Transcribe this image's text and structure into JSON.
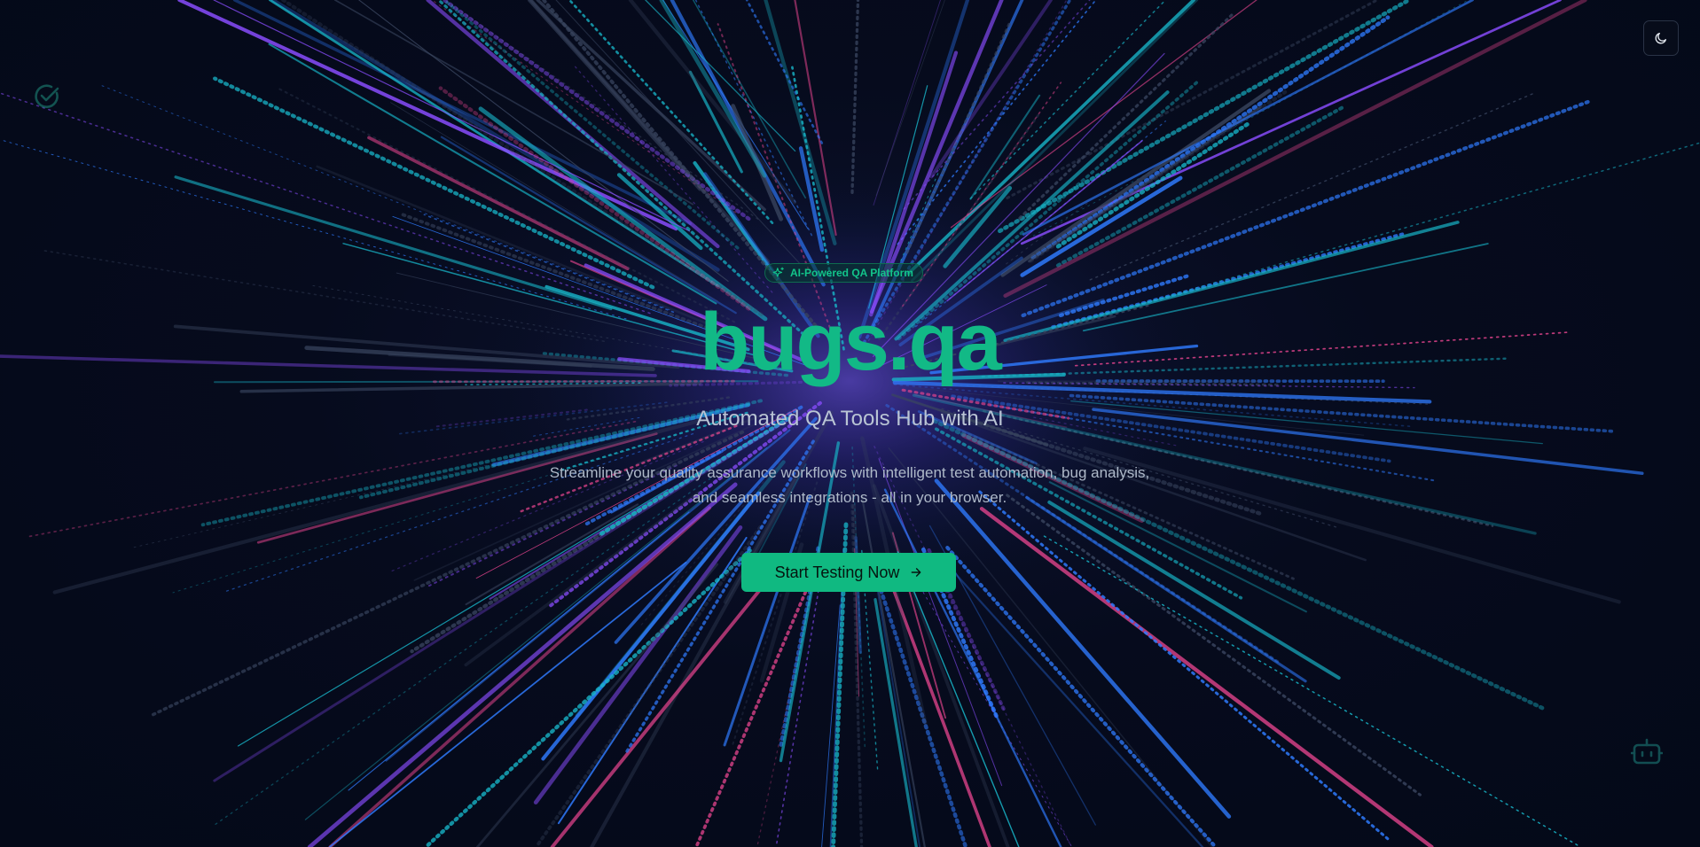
{
  "header": {
    "theme_toggle_icon": "moon-icon"
  },
  "decorations": {
    "top_left_icon": "check-circle-icon",
    "bottom_right_icon": "bot-icon"
  },
  "hero": {
    "badge_icon": "sparkles-icon",
    "badge_label": "AI-Powered QA Platform",
    "title": "bugs.qa",
    "subtitle": "Automated QA Tools Hub with AI",
    "description": "Streamline your quality assurance workflows with intelligent test automation, bug analysis, and seamless integrations - all in your browser.",
    "cta_label": "Start Testing Now",
    "cta_icon": "arrow-right-icon"
  },
  "colors": {
    "background": "#050a1a",
    "accent": "#10b981",
    "burst_pink": "#e8458f",
    "burst_blue": "#2f7bff",
    "burst_cyan": "#18b6c9",
    "burst_violet": "#8a4dff",
    "burst_slate": "#3a4660"
  }
}
